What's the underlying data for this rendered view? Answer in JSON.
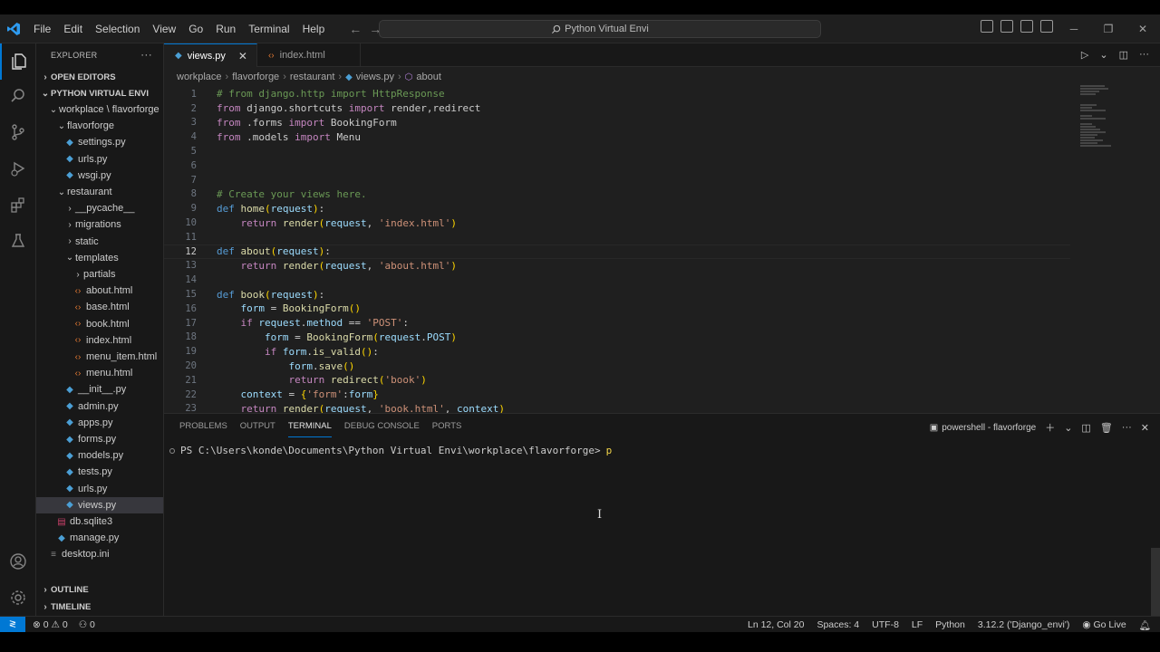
{
  "titlebar": {
    "menu": [
      "File",
      "Edit",
      "Selection",
      "View",
      "Go",
      "Run",
      "Terminal",
      "Help"
    ],
    "search_text": "Python Virtual Envi"
  },
  "sidebar": {
    "title": "EXPLORER",
    "open_editors": "OPEN EDITORS",
    "root": "PYTHON VIRTUAL ENVI",
    "tree": [
      {
        "label": "workplace \\ flavorforge",
        "type": "folder-open",
        "depth": 1
      },
      {
        "label": "flavorforge",
        "type": "folder-open",
        "depth": 2
      },
      {
        "label": "settings.py",
        "type": "py",
        "depth": 3
      },
      {
        "label": "urls.py",
        "type": "py",
        "depth": 3
      },
      {
        "label": "wsgi.py",
        "type": "py",
        "depth": 3
      },
      {
        "label": "restaurant",
        "type": "folder-open",
        "depth": 2
      },
      {
        "label": "__pycache__",
        "type": "folder-closed",
        "depth": 3
      },
      {
        "label": "migrations",
        "type": "folder-closed",
        "depth": 3
      },
      {
        "label": "static",
        "type": "folder-closed",
        "depth": 3
      },
      {
        "label": "templates",
        "type": "folder-open",
        "depth": 3
      },
      {
        "label": "partials",
        "type": "folder-closed",
        "depth": 4
      },
      {
        "label": "about.html",
        "type": "html",
        "depth": 4
      },
      {
        "label": "base.html",
        "type": "html",
        "depth": 4
      },
      {
        "label": "book.html",
        "type": "html",
        "depth": 4
      },
      {
        "label": "index.html",
        "type": "html",
        "depth": 4
      },
      {
        "label": "menu_item.html",
        "type": "html",
        "depth": 4
      },
      {
        "label": "menu.html",
        "type": "html",
        "depth": 4
      },
      {
        "label": "__init__.py",
        "type": "py",
        "depth": 3
      },
      {
        "label": "admin.py",
        "type": "py",
        "depth": 3
      },
      {
        "label": "apps.py",
        "type": "py",
        "depth": 3
      },
      {
        "label": "forms.py",
        "type": "py",
        "depth": 3
      },
      {
        "label": "models.py",
        "type": "py",
        "depth": 3
      },
      {
        "label": "tests.py",
        "type": "py",
        "depth": 3
      },
      {
        "label": "urls.py",
        "type": "py",
        "depth": 3
      },
      {
        "label": "views.py",
        "type": "py",
        "depth": 3,
        "selected": true
      },
      {
        "label": "db.sqlite3",
        "type": "db",
        "depth": 2
      },
      {
        "label": "manage.py",
        "type": "py",
        "depth": 2
      },
      {
        "label": "desktop.ini",
        "type": "ini",
        "depth": 1
      }
    ],
    "outline": "OUTLINE",
    "timeline": "TIMELINE"
  },
  "editor": {
    "tabs": [
      {
        "label": "views.py",
        "active": true
      },
      {
        "label": "index.html",
        "active": false
      }
    ],
    "breadcrumb": [
      "workplace",
      "flavorforge",
      "restaurant",
      "views.py",
      "about"
    ],
    "current_line": 12,
    "lines": [
      [
        [
          "c",
          "# from django.http import HttpResponse"
        ]
      ],
      [
        [
          "kc",
          "from"
        ],
        [
          "t",
          " django.shortcuts "
        ],
        [
          "kc",
          "import"
        ],
        [
          "t",
          " render,redirect"
        ]
      ],
      [
        [
          "kc",
          "from"
        ],
        [
          "t",
          " .forms "
        ],
        [
          "kc",
          "import"
        ],
        [
          "t",
          " BookingForm"
        ]
      ],
      [
        [
          "kc",
          "from"
        ],
        [
          "t",
          " .models "
        ],
        [
          "kc",
          "import"
        ],
        [
          "t",
          " Menu"
        ]
      ],
      [],
      [],
      [],
      [
        [
          "c",
          "# Create your views here."
        ]
      ],
      [
        [
          "k",
          "def"
        ],
        [
          "t",
          " "
        ],
        [
          "f",
          "home"
        ],
        [
          "p",
          "("
        ],
        [
          "v",
          "request"
        ],
        [
          "p",
          ")"
        ],
        [
          "t",
          ":"
        ]
      ],
      [
        [
          "t",
          "    "
        ],
        [
          "kc",
          "return"
        ],
        [
          "t",
          " "
        ],
        [
          "f",
          "render"
        ],
        [
          "p",
          "("
        ],
        [
          "v",
          "request"
        ],
        [
          "t",
          ", "
        ],
        [
          "s",
          "'index.html'"
        ],
        [
          "p",
          ")"
        ]
      ],
      [],
      [
        [
          "k",
          "def"
        ],
        [
          "t",
          " "
        ],
        [
          "f",
          "about"
        ],
        [
          "p",
          "("
        ],
        [
          "v",
          "request"
        ],
        [
          "p",
          ")"
        ],
        [
          "t",
          ":"
        ]
      ],
      [
        [
          "t",
          "    "
        ],
        [
          "kc",
          "return"
        ],
        [
          "t",
          " "
        ],
        [
          "f",
          "render"
        ],
        [
          "p",
          "("
        ],
        [
          "v",
          "request"
        ],
        [
          "t",
          ", "
        ],
        [
          "s",
          "'about.html'"
        ],
        [
          "p",
          ")"
        ]
      ],
      [],
      [
        [
          "k",
          "def"
        ],
        [
          "t",
          " "
        ],
        [
          "f",
          "book"
        ],
        [
          "p",
          "("
        ],
        [
          "v",
          "request"
        ],
        [
          "p",
          ")"
        ],
        [
          "t",
          ":"
        ]
      ],
      [
        [
          "t",
          "    "
        ],
        [
          "v",
          "form"
        ],
        [
          "t",
          " = "
        ],
        [
          "f",
          "BookingForm"
        ],
        [
          "p",
          "()"
        ]
      ],
      [
        [
          "t",
          "    "
        ],
        [
          "kc",
          "if"
        ],
        [
          "t",
          " "
        ],
        [
          "v",
          "request"
        ],
        [
          "t",
          "."
        ],
        [
          "v",
          "method"
        ],
        [
          "t",
          " == "
        ],
        [
          "s",
          "'POST'"
        ],
        [
          "t",
          ":"
        ]
      ],
      [
        [
          "t",
          "        "
        ],
        [
          "v",
          "form"
        ],
        [
          "t",
          " = "
        ],
        [
          "f",
          "BookingForm"
        ],
        [
          "p",
          "("
        ],
        [
          "v",
          "request"
        ],
        [
          "t",
          "."
        ],
        [
          "v",
          "POST"
        ],
        [
          "p",
          ")"
        ]
      ],
      [
        [
          "t",
          "        "
        ],
        [
          "kc",
          "if"
        ],
        [
          "t",
          " "
        ],
        [
          "v",
          "form"
        ],
        [
          "t",
          "."
        ],
        [
          "f",
          "is_valid"
        ],
        [
          "p",
          "()"
        ],
        [
          "t",
          ":"
        ]
      ],
      [
        [
          "t",
          "            "
        ],
        [
          "v",
          "form"
        ],
        [
          "t",
          "."
        ],
        [
          "f",
          "save"
        ],
        [
          "p",
          "()"
        ]
      ],
      [
        [
          "t",
          "            "
        ],
        [
          "kc",
          "return"
        ],
        [
          "t",
          " "
        ],
        [
          "f",
          "redirect"
        ],
        [
          "p",
          "("
        ],
        [
          "s",
          "'book'"
        ],
        [
          "p",
          ")"
        ]
      ],
      [
        [
          "t",
          "    "
        ],
        [
          "v",
          "context"
        ],
        [
          "t",
          " = "
        ],
        [
          "p",
          "{"
        ],
        [
          "s",
          "'form'"
        ],
        [
          "t",
          ":"
        ],
        [
          "v",
          "form"
        ],
        [
          "p",
          "}"
        ]
      ],
      [
        [
          "t",
          "    "
        ],
        [
          "kc",
          "return"
        ],
        [
          "t",
          " "
        ],
        [
          "f",
          "render"
        ],
        [
          "p",
          "("
        ],
        [
          "v",
          "request"
        ],
        [
          "t",
          ", "
        ],
        [
          "s",
          "'book.html'"
        ],
        [
          "t",
          ", "
        ],
        [
          "v",
          "context"
        ],
        [
          "p",
          ")"
        ]
      ]
    ]
  },
  "panel": {
    "tabs": [
      "PROBLEMS",
      "OUTPUT",
      "TERMINAL",
      "DEBUG CONSOLE",
      "PORTS"
    ],
    "active_tab": "TERMINAL",
    "terminal_name": "powershell - flavorforge",
    "prompt": "PS C:\\Users\\konde\\Documents\\Python Virtual Envi\\workplace\\flavorforge>",
    "typed": "p"
  },
  "statusbar": {
    "errors": "0",
    "warnings": "0",
    "ports": "0",
    "position": "Ln 12, Col 20",
    "spaces": "Spaces: 4",
    "encoding": "UTF-8",
    "eol": "LF",
    "language": "Python",
    "interpreter": "3.12.2 ('Django_envi')",
    "golive": "Go Live"
  },
  "colors": {
    "accent": "#0078d4",
    "keyword": "#569cd6",
    "control": "#c586c0",
    "function": "#dcdcaa",
    "string": "#ce9178",
    "comment": "#6a9955",
    "variable": "#9cdcfe"
  }
}
